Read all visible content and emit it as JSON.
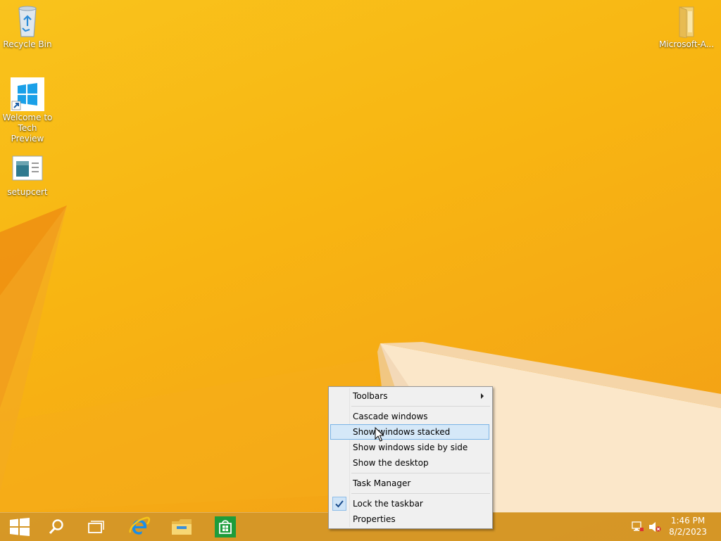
{
  "desktop": {
    "icons": [
      {
        "label": "Recycle Bin",
        "icon": "recycle-bin-icon"
      },
      {
        "label": "Welcome to Tech Preview",
        "icon": "windows-logo-shortcut-icon"
      },
      {
        "label": "setupcert",
        "icon": "certificate-file-icon"
      },
      {
        "label": "Microsoft-A...",
        "icon": "folder-icon"
      }
    ]
  },
  "context_menu": {
    "items": [
      {
        "label": "Toolbars",
        "has_submenu": true
      },
      {
        "label": "Cascade windows"
      },
      {
        "label": "Show windows stacked",
        "highlighted": true
      },
      {
        "label": "Show windows side by side"
      },
      {
        "label": "Show the desktop"
      },
      {
        "label": "Task Manager"
      },
      {
        "label": "Lock the taskbar",
        "checked": true
      },
      {
        "label": "Properties"
      }
    ]
  },
  "taskbar": {
    "buttons": [
      {
        "icon": "start-icon"
      },
      {
        "icon": "search-icon"
      },
      {
        "icon": "task-view-icon"
      },
      {
        "icon": "internet-explorer-icon"
      },
      {
        "icon": "file-explorer-icon"
      },
      {
        "icon": "store-icon"
      }
    ],
    "tray": {
      "network_icon": "network-icon",
      "volume_icon": "volume-muted-icon",
      "time": "1:46 PM",
      "date": "8/2/2023"
    }
  },
  "colors": {
    "wallpaper": "#f8b512",
    "taskbar": "#d3962a",
    "menu_bg": "#f0f0f0",
    "menu_highlight": "#d5e8f8"
  }
}
